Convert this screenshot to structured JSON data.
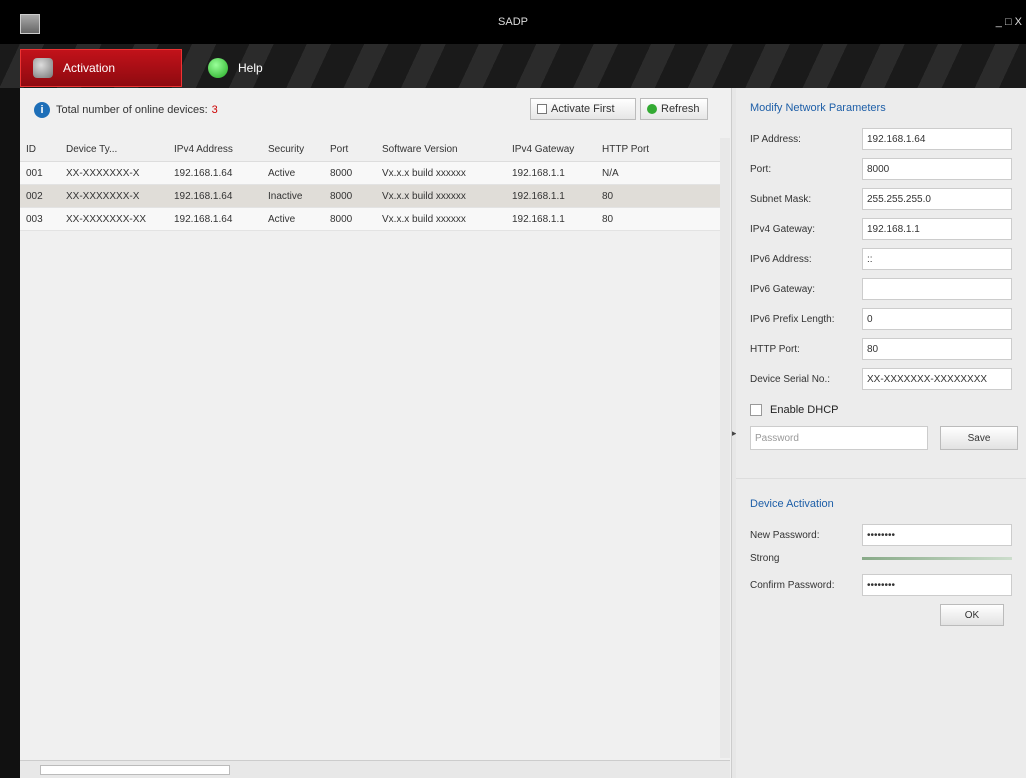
{
  "window": {
    "title": "SADP",
    "controls": "_ □ X"
  },
  "tabs": [
    {
      "label": "Activation"
    },
    {
      "label": "Help"
    }
  ],
  "info": {
    "text": "Total number of online devices:",
    "count": "3"
  },
  "toolbar": {
    "activate_first_label": "Activate First",
    "refresh_label": "Refresh"
  },
  "table": {
    "headers": [
      "ID",
      "Device Ty...",
      "IPv4 Address",
      "Security",
      "Port",
      "Software Version",
      "IPv4 Gateway",
      "HTTP Port"
    ],
    "rows": [
      [
        "001",
        "XX-XXXXXXX-X",
        "192.168.1.64",
        "Active",
        "8000",
        "Vx.x.x build xxxxxx",
        "192.168.1.1",
        "N/A"
      ],
      [
        "002",
        "XX-XXXXXXX-X",
        "192.168.1.64",
        "Inactive",
        "8000",
        "Vx.x.x build xxxxxx",
        "192.168.1.1",
        "80"
      ],
      [
        "003",
        "XX-XXXXXXX-XX",
        "192.168.1.64",
        "Active",
        "8000",
        "Vx.x.x build xxxxxx",
        "192.168.1.1",
        "80"
      ]
    ]
  },
  "modify": {
    "title": "Modify Network Parameters",
    "fields": [
      {
        "label": "IP Address:",
        "value": "192.168.1.64"
      },
      {
        "label": "Port:",
        "value": "8000"
      },
      {
        "label": "Subnet Mask:",
        "value": "255.255.255.0"
      },
      {
        "label": "IPv4 Gateway:",
        "value": "192.168.1.1"
      },
      {
        "label": "IPv6 Address:",
        "value": "::"
      },
      {
        "label": "IPv6 Gateway:",
        "value": ""
      },
      {
        "label": "IPv6 Prefix Length:",
        "value": "0"
      },
      {
        "label": "HTTP Port:",
        "value": "80"
      },
      {
        "label": "Device Serial No.:",
        "value": "XX-XXXXXXX-XXXXXXXX"
      }
    ],
    "enable_dhcp": "Enable DHCP",
    "password_placeholder": "Password",
    "save_label": "Save"
  },
  "activate": {
    "title": "Device Activation",
    "new_password_label": "New Password:",
    "new_password_value": "••••••••",
    "strength_label": "Strong",
    "confirm_label": "Confirm Password:",
    "confirm_value": "••••••••",
    "ok_label": "OK"
  }
}
